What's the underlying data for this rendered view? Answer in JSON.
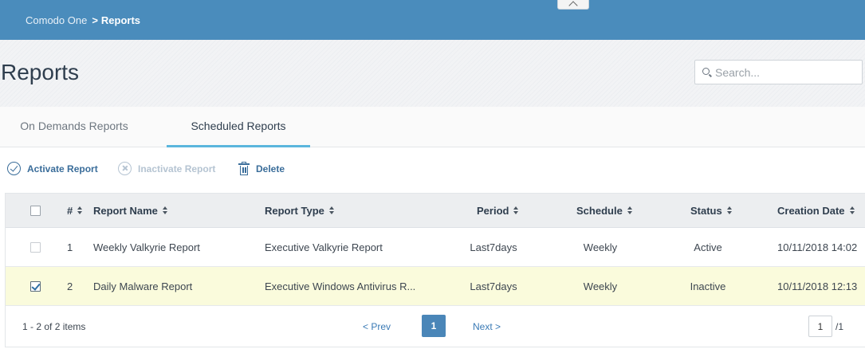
{
  "breadcrumb": {
    "root": "Comodo One",
    "separator": ">",
    "current": "Reports"
  },
  "page": {
    "title": "Reports"
  },
  "search": {
    "placeholder": "Search..."
  },
  "tabs": [
    {
      "label": "On Demands Reports",
      "active": false
    },
    {
      "label": "Scheduled Reports",
      "active": true
    }
  ],
  "toolbar": {
    "activate_label": "Activate Report",
    "inactivate_label": "Inactivate Report",
    "delete_label": "Delete"
  },
  "table": {
    "columns": [
      "#",
      "Report Name",
      "Report Type",
      "Period",
      "Schedule",
      "Status",
      "Creation Date"
    ],
    "rows": [
      {
        "num": "1",
        "name": "Weekly Valkyrie Report",
        "type": "Executive Valkyrie Report",
        "period": "Last7days",
        "schedule": "Weekly",
        "status": "Active",
        "created": "10/11/2018 14:02",
        "checked": false
      },
      {
        "num": "2",
        "name": "Daily Malware Report",
        "type": "Executive Windows Antivirus R...",
        "period": "Last7days",
        "schedule": "Weekly",
        "status": "Inactive",
        "created": "10/11/2018 12:13",
        "checked": true
      }
    ]
  },
  "pagination": {
    "info": "1 - 2 of 2 items",
    "prev_label": "< Prev",
    "current_page": "1",
    "next_label": "Next >",
    "page_input_value": "1",
    "total_pages": "/1"
  },
  "colors": {
    "header_bar": "#4a8cbc",
    "accent": "#5bb6dd",
    "selected_row": "#fafbdc",
    "action_blue": "#3a6d9a"
  }
}
